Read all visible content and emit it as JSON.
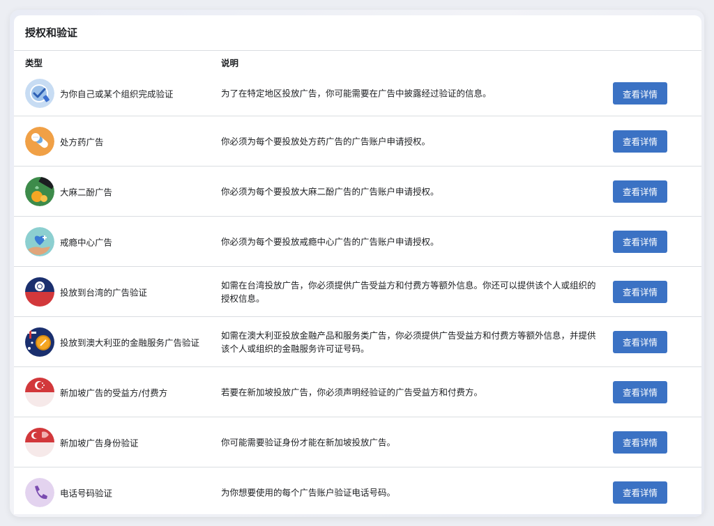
{
  "card": {
    "title": "授权和验证",
    "columns": {
      "type": "类型",
      "description": "说明"
    }
  },
  "rows": [
    {
      "icon": "verified-check-icon",
      "type": "为你自己或某个组织完成验证",
      "description": "为了在特定地区投放广告，你可能需要在广告中披露经过验证的信息。",
      "button": "查看详情"
    },
    {
      "icon": "pill-icon",
      "type": "处方药广告",
      "description": "你必须为每个要投放处方药广告的广告账户申请授权。",
      "button": "查看详情"
    },
    {
      "icon": "cannabis-oil-icon",
      "type": "大麻二酚广告",
      "description": "你必须为每个要投放大麻二酚广告的广告账户申请授权。",
      "button": "查看详情"
    },
    {
      "icon": "heart-hand-icon",
      "type": "戒瘾中心广告",
      "description": "你必须为每个要投放戒瘾中心广告的广告账户申请授权。",
      "button": "查看详情"
    },
    {
      "icon": "taiwan-flag-icon",
      "type": "投放到台湾的广告验证",
      "description": "如需在台湾投放广告，你必须提供广告受益方和付费方等额外信息。你还可以提供该个人或组织的授权信息。",
      "button": "查看详情"
    },
    {
      "icon": "australia-flag-coin-icon",
      "type": "投放到澳大利亚的金融服务广告验证",
      "description": "如需在澳大利亚投放金融产品和服务类广告，你必须提供广告受益方和付费方等额外信息，并提供该个人或组织的金融服务许可证号码。",
      "button": "查看详情"
    },
    {
      "icon": "singapore-flag-icon",
      "type": "新加坡广告的受益方/付费方",
      "description": "若要在新加坡投放广告，你必须声明经验证的广告受益方和付费方。",
      "button": "查看详情"
    },
    {
      "icon": "singapore-flag-id-icon",
      "type": "新加坡广告身份验证",
      "description": "你可能需要验证身份才能在新加坡投放广告。",
      "button": "查看详情"
    },
    {
      "icon": "phone-icon",
      "type": "电话号码验证",
      "description": "为你想要使用的每个广告账户验证电话号码。",
      "button": "查看详情"
    }
  ],
  "colors": {
    "button": "#3b72c4",
    "divider": "#dadde1",
    "text": "#1c1e21"
  }
}
